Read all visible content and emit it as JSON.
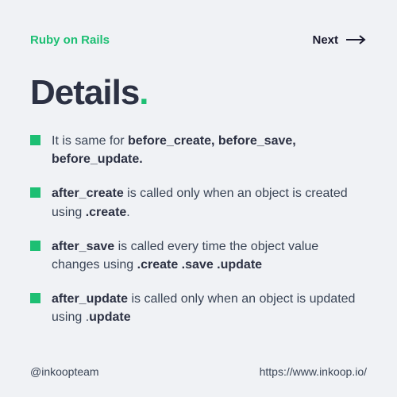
{
  "header": {
    "brand": "Ruby on Rails",
    "next_label": "Next"
  },
  "title": "Details",
  "items": [
    {
      "pre": "It is same for ",
      "bold1": "before_create, before_save, before_update.",
      "mid": "",
      "bold2": "",
      "post": ""
    },
    {
      "pre": "",
      "bold1": "after_create",
      "mid": " is called only when an object is created using ",
      "bold2": ".create",
      "post": "."
    },
    {
      "pre": "",
      "bold1": "after_save",
      "mid": " is called every time the object value changes using ",
      "bold2": ".create .save .update",
      "post": ""
    },
    {
      "pre": "",
      "bold1": "after_update",
      "mid": " is called only when an object is updated using .",
      "bold2": "update",
      "post": ""
    }
  ],
  "footer": {
    "handle": "@inkoopteam",
    "url": "https://www.inkoop.io/"
  }
}
